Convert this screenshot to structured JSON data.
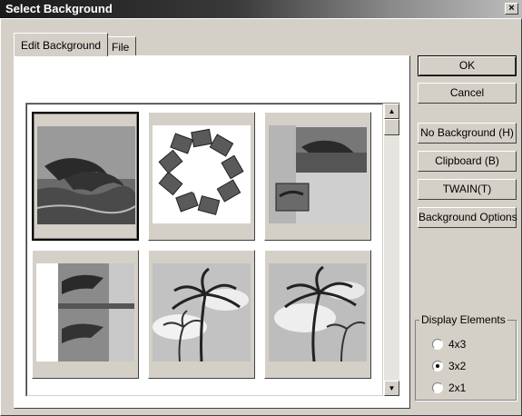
{
  "window": {
    "title": "Select Background",
    "close_glyph": "×"
  },
  "tabs": [
    {
      "label": "Edit Background",
      "active": true
    },
    {
      "label": "File",
      "active": false
    }
  ],
  "buttons": {
    "ok": "OK",
    "cancel": "Cancel",
    "no_background": "No Background (H)",
    "clipboard": "Clipboard (B)",
    "twain": "TWAIN(T)",
    "background_options": "Background Options"
  },
  "display_elements": {
    "label": "Display Elements",
    "options": [
      {
        "label": "4x3",
        "checked": false
      },
      {
        "label": "3x2",
        "checked": true
      },
      {
        "label": "2x1",
        "checked": false
      }
    ]
  },
  "thumbnails": [
    {
      "name": "dolphins-ocean",
      "selected": true
    },
    {
      "name": "dolphin-photo-ring",
      "selected": false
    },
    {
      "name": "dolphins-collage",
      "selected": false
    },
    {
      "name": "dolphins-strips",
      "selected": false
    },
    {
      "name": "palm-trees-sky",
      "selected": false
    },
    {
      "name": "palm-trees-framed",
      "selected": false
    }
  ],
  "scrollbar": {
    "up_glyph": "▲",
    "down_glyph": "▼"
  },
  "colors": {
    "face": "#d4d0c8",
    "title_gradient_start": "#1a1a1a",
    "panel": "#ffffff"
  }
}
